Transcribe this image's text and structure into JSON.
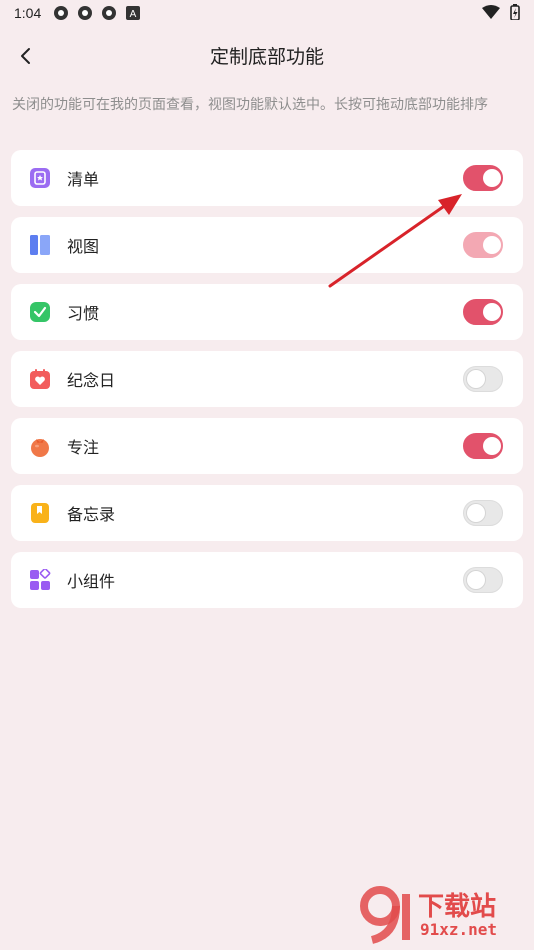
{
  "status": {
    "time": "1:04"
  },
  "header": {
    "title": "定制底部功能"
  },
  "hint": "关闭的功能可在我的页面查看，视图功能默认选中。长按可拖动底部功能排序",
  "items": [
    {
      "label": "清单",
      "icon": "checklist-icon",
      "enabled": true,
      "color": "#9b6cf2"
    },
    {
      "label": "视图",
      "icon": "view-icon",
      "enabled": true,
      "color": "#6f8ff5"
    },
    {
      "label": "习惯",
      "icon": "habit-check-icon",
      "enabled": true,
      "color": "#35c567"
    },
    {
      "label": "纪念日",
      "icon": "calendar-heart-icon",
      "enabled": false,
      "color": "#f25c5c"
    },
    {
      "label": "专注",
      "icon": "tomato-icon",
      "enabled": true,
      "color": "#f07848"
    },
    {
      "label": "备忘录",
      "icon": "memo-icon",
      "enabled": false,
      "color": "#f9b21a"
    },
    {
      "label": "小组件",
      "icon": "widget-icon",
      "enabled": false,
      "color": "#9a5cf2"
    }
  ],
  "colors": {
    "accent": "#e2526b",
    "background": "#f7ecee"
  },
  "watermark": {
    "line1": "下载站",
    "line2": "91xz.net"
  }
}
